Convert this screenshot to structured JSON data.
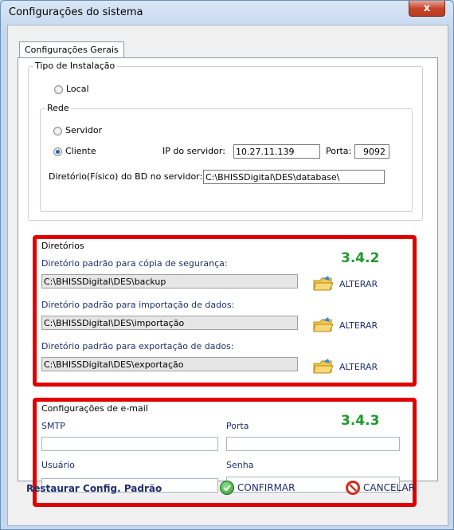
{
  "window": {
    "title": "Configurações do sistema",
    "close_glyph": "x"
  },
  "tabs": [
    {
      "label": "Configurações Gerais"
    }
  ],
  "instalacao": {
    "legend": "Tipo de Instalação",
    "local_label": "Local",
    "rede": {
      "legend": "Rede",
      "servidor_label": "Servidor",
      "cliente_label": "Cliente",
      "selected": "Cliente",
      "ip_label": "IP do servidor:",
      "ip_value": "10.27.11.139",
      "porta_label": "Porta:",
      "porta_value": "9092",
      "dir_label": "Diretório(Físico) do BD no servidor:",
      "dir_value": "C:\\BHISSDigital\\DES\\database\\"
    }
  },
  "diretorios": {
    "legend": "Diretórios",
    "annotation": "3.4.2",
    "items": [
      {
        "label": "Diretório padrão para cópia de segurança:",
        "value": "C:\\BHISSDigital\\DES\\backup",
        "button": "ALTERAR"
      },
      {
        "label": "Diretório padrão para importação de dados:",
        "value": "C:\\BHISSDigital\\DES\\importação",
        "button": "ALTERAR"
      },
      {
        "label": "Diretório padrão para exportação de dados:",
        "value": "C:\\BHISSDigital\\DES\\exportação",
        "button": "ALTERAR"
      }
    ]
  },
  "email": {
    "legend": "Configurações de e-mail",
    "annotation": "3.4.3",
    "smtp_label": "SMTP",
    "smtp_value": "",
    "porta_label": "Porta",
    "porta_value": "",
    "usuario_label": "Usuário",
    "usuario_value": "",
    "senha_label": "Senha",
    "senha_value": ""
  },
  "footer": {
    "restaurar": "Restaurar Config. Padrão",
    "confirmar": "CONFIRMAR",
    "cancelar": "CANCELAR"
  },
  "colors": {
    "highlight_border": "#e00000",
    "annotation": "#1c9a2a",
    "link_text": "#1f2f6e"
  }
}
